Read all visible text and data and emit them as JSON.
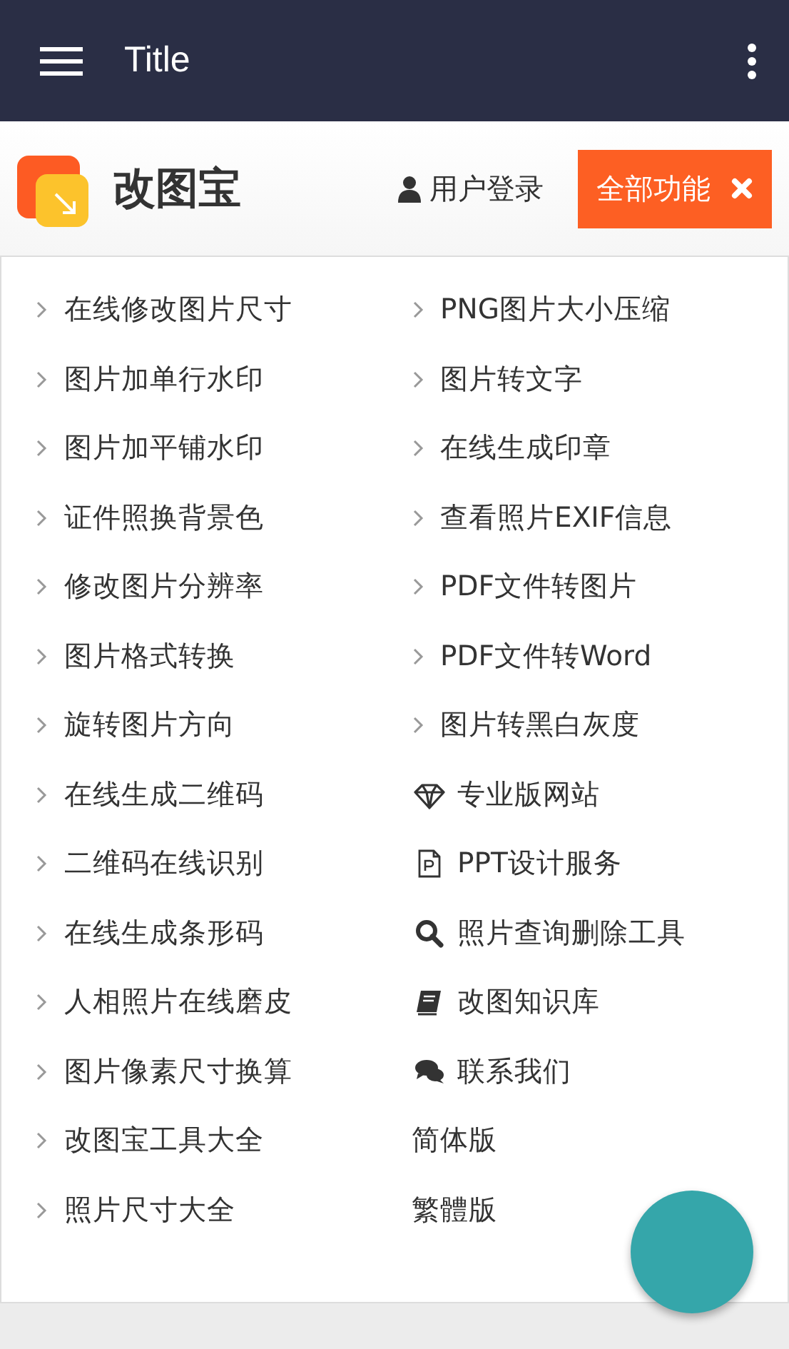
{
  "app_bar": {
    "title": "Title"
  },
  "header": {
    "brand": "改图宝",
    "login": "用户登录",
    "all_features": "全部功能"
  },
  "menu": {
    "left": [
      {
        "label": "在线修改图片尺寸",
        "kind": "chevron"
      },
      {
        "label": "图片加单行水印",
        "kind": "chevron"
      },
      {
        "label": "图片加平铺水印",
        "kind": "chevron"
      },
      {
        "label": "证件照换背景色",
        "kind": "chevron"
      },
      {
        "label": "修改图片分辨率",
        "kind": "chevron"
      },
      {
        "label": "图片格式转换",
        "kind": "chevron"
      },
      {
        "label": "旋转图片方向",
        "kind": "chevron"
      },
      {
        "label": "在线生成二维码",
        "kind": "chevron"
      },
      {
        "label": "二维码在线识别",
        "kind": "chevron"
      },
      {
        "label": "在线生成条形码",
        "kind": "chevron"
      },
      {
        "label": "人相照片在线磨皮",
        "kind": "chevron"
      },
      {
        "label": "图片像素尺寸换算",
        "kind": "chevron"
      },
      {
        "label": "改图宝工具大全",
        "kind": "chevron"
      },
      {
        "label": "照片尺寸大全",
        "kind": "chevron"
      }
    ],
    "right": [
      {
        "label": "PNG图片大小压缩",
        "kind": "chevron"
      },
      {
        "label": "图片转文字",
        "kind": "chevron"
      },
      {
        "label": "在线生成印章",
        "kind": "chevron"
      },
      {
        "label": "查看照片EXIF信息",
        "kind": "chevron"
      },
      {
        "label": "PDF文件转图片",
        "kind": "chevron"
      },
      {
        "label": "PDF文件转Word",
        "kind": "chevron"
      },
      {
        "label": "图片转黑白灰度",
        "kind": "chevron"
      },
      {
        "label": "专业版网站",
        "kind": "icon"
      },
      {
        "label": "PPT设计服务",
        "kind": "icon"
      },
      {
        "label": "照片查询删除工具",
        "kind": "icon"
      },
      {
        "label": "改图知识库",
        "kind": "icon"
      },
      {
        "label": "联系我们",
        "kind": "icon"
      },
      {
        "label": "简体版",
        "kind": "plain"
      },
      {
        "label": "繁體版",
        "kind": "plain"
      }
    ]
  }
}
